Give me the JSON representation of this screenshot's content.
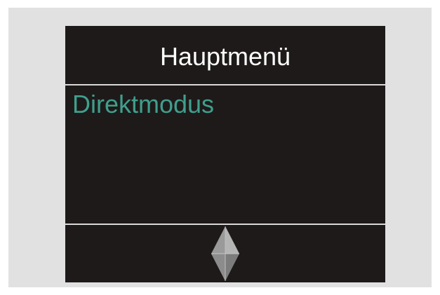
{
  "screen": {
    "title": "Hauptmenü",
    "menu_items": [
      {
        "label": "Direktmodus",
        "selected": true
      }
    ],
    "nav_icon": "up-down-arrow-icon"
  },
  "colors": {
    "frame": "#e1e1e1",
    "screen_background": "#1e1a19",
    "title_text": "#ffffff",
    "menu_text": "#3f9f8d",
    "divider": "#d9d9d9",
    "arrow_fill": "#8a8a8a"
  }
}
